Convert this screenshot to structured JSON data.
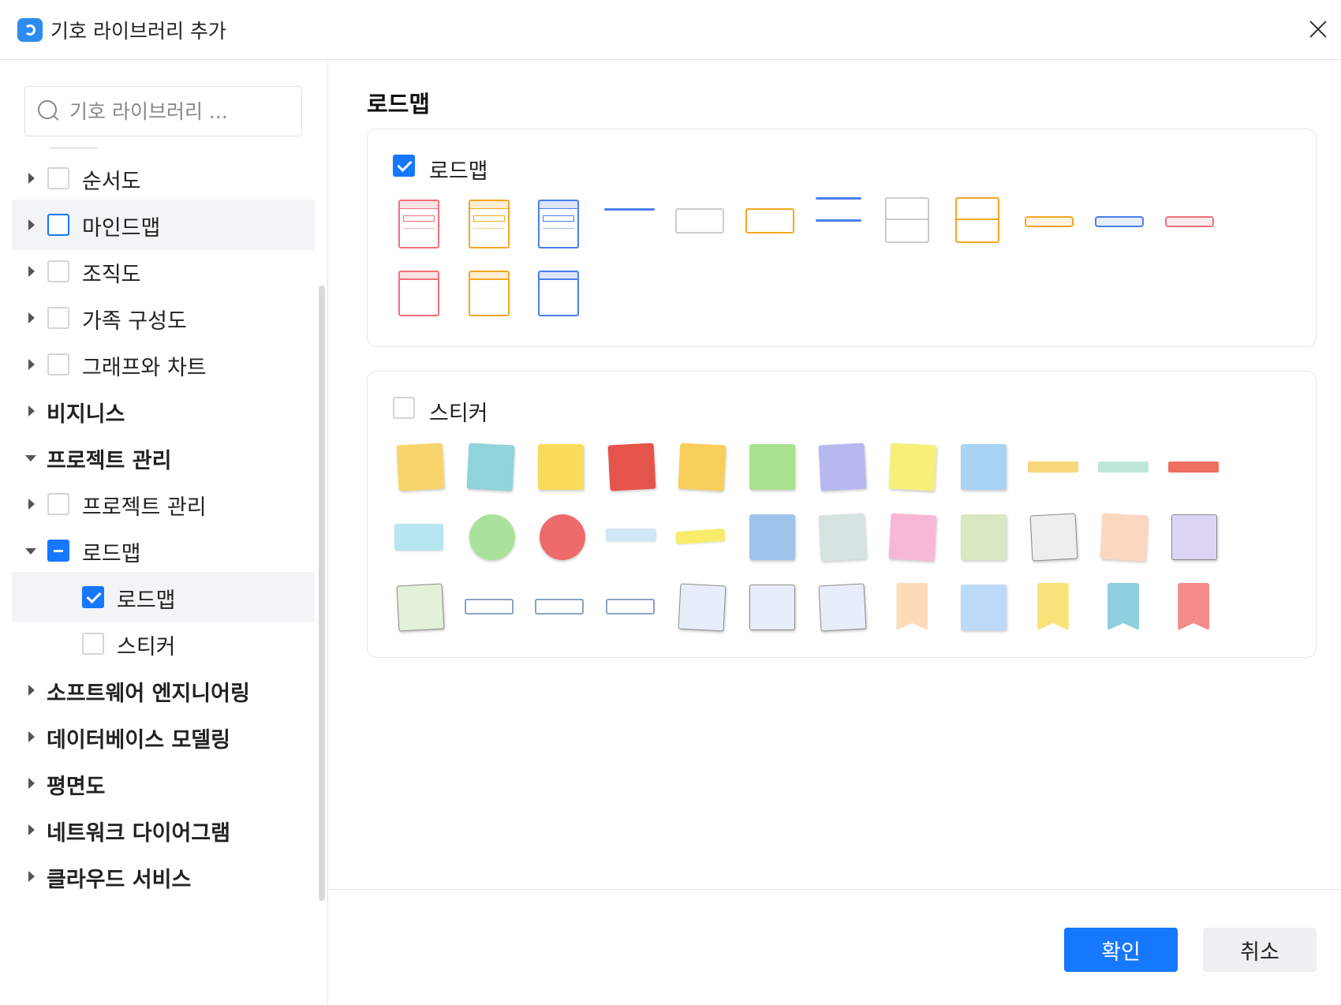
{
  "window": {
    "title": "기호 라이브러리 추가"
  },
  "search": {
    "placeholder": "기호 라이브러리 ..."
  },
  "tree": [
    {
      "label": "순서도",
      "bold": false,
      "level": 1,
      "arrow": "right",
      "checkbox": "empty",
      "highlight": false
    },
    {
      "label": "마인드맵",
      "bold": false,
      "level": 1,
      "arrow": "right",
      "checkbox": "empty-blue",
      "highlight": true
    },
    {
      "label": "조직도",
      "bold": false,
      "level": 1,
      "arrow": "right",
      "checkbox": "empty",
      "highlight": false
    },
    {
      "label": "가족 구성도",
      "bold": false,
      "level": 1,
      "arrow": "right",
      "checkbox": "empty",
      "highlight": false
    },
    {
      "label": "그래프와 차트",
      "bold": false,
      "level": 1,
      "arrow": "right",
      "checkbox": "empty",
      "highlight": false
    },
    {
      "label": "비지니스",
      "bold": true,
      "level": 0,
      "arrow": "right",
      "checkbox": "none",
      "highlight": false
    },
    {
      "label": "프로젝트 관리",
      "bold": true,
      "level": 0,
      "arrow": "down",
      "checkbox": "none",
      "highlight": false
    },
    {
      "label": "프로젝트 관리",
      "bold": false,
      "level": 1,
      "arrow": "right",
      "checkbox": "empty",
      "highlight": false
    },
    {
      "label": "로드맵",
      "bold": false,
      "level": 1,
      "arrow": "down",
      "checkbox": "partial",
      "highlight": false
    },
    {
      "label": "로드맵",
      "bold": false,
      "level": 2,
      "arrow": "none",
      "checkbox": "checked",
      "highlight": true
    },
    {
      "label": "스티커",
      "bold": false,
      "level": 2,
      "arrow": "none",
      "checkbox": "empty",
      "highlight": false
    },
    {
      "label": "소프트웨어 엔지니어링",
      "bold": true,
      "level": 0,
      "arrow": "right",
      "checkbox": "none",
      "highlight": false
    },
    {
      "label": "데이터베이스 모델링",
      "bold": true,
      "level": 0,
      "arrow": "right",
      "checkbox": "none",
      "highlight": false
    },
    {
      "label": "평면도",
      "bold": true,
      "level": 0,
      "arrow": "right",
      "checkbox": "none",
      "highlight": false
    },
    {
      "label": "네트워크 다이어그램",
      "bold": true,
      "level": 0,
      "arrow": "right",
      "checkbox": "none",
      "highlight": false
    },
    {
      "label": "클라우드 서비스",
      "bold": true,
      "level": 0,
      "arrow": "right",
      "checkbox": "none",
      "highlight": false
    }
  ],
  "main": {
    "title": "로드맵",
    "panels": [
      {
        "label": "로드맵",
        "checked": true
      },
      {
        "label": "스티커",
        "checked": false
      }
    ]
  },
  "roadmap_symbols": [
    {
      "name": "timeline-card-red",
      "color": "#f0707a"
    },
    {
      "name": "timeline-card-orange",
      "color": "#f5a623"
    },
    {
      "name": "timeline-card-blue",
      "color": "#4a7ef0"
    },
    {
      "name": "line-blue",
      "color": "#4a7ef0"
    },
    {
      "name": "box-gray",
      "color": "#cccccc"
    },
    {
      "name": "box-orange",
      "color": "#f5a623"
    },
    {
      "name": "double-line-blue",
      "color": "#4a7ef0"
    },
    {
      "name": "split-box-gray",
      "color": "#cccccc"
    },
    {
      "name": "split-box-orange",
      "color": "#f5a623"
    },
    {
      "name": "tag-orange",
      "color": "#f5a623"
    },
    {
      "name": "tag-blue",
      "color": "#4a7ef0"
    },
    {
      "name": "tag-red",
      "color": "#f0707a"
    },
    {
      "name": "swimlane-red",
      "color": "#f0707a"
    },
    {
      "name": "swimlane-orange",
      "color": "#f5a623"
    },
    {
      "name": "swimlane-blue",
      "color": "#4a7ef0"
    }
  ],
  "sticker_symbols": [
    {
      "name": "note-yellow",
      "color": "#f7d56b"
    },
    {
      "name": "note-teal",
      "color": "#8fd3db"
    },
    {
      "name": "note-yellow-pin",
      "color": "#f9dc5c"
    },
    {
      "name": "note-red",
      "color": "#e5544b"
    },
    {
      "name": "note-orange-curl",
      "color": "#f8cf5a"
    },
    {
      "name": "note-green-clip",
      "color": "#a9e28f"
    },
    {
      "name": "note-purple-clip",
      "color": "#b8b8f0"
    },
    {
      "name": "note-yellow-pushpin",
      "color": "#f6ef7a"
    },
    {
      "name": "note-blue-pushpin",
      "color": "#a9d3f5"
    },
    {
      "name": "tag-yellow",
      "color": "#f8d87a"
    },
    {
      "name": "tag-mint",
      "color": "#bfe8d8"
    },
    {
      "name": "tag-red-arrow",
      "color": "#f07060"
    },
    {
      "name": "note-cyan-tape",
      "color": "#b7e6f0"
    },
    {
      "name": "circle-green",
      "color": "#a9e29a"
    },
    {
      "name": "circle-red",
      "color": "#ee6b6b"
    },
    {
      "name": "tag-light-blue",
      "color": "#cfe6f7"
    },
    {
      "name": "ribbon-yellow",
      "color": "#f9ec6b"
    },
    {
      "name": "note-blue-clip",
      "color": "#9fc4ea"
    },
    {
      "name": "note-gray-tape",
      "color": "#d6e3e0"
    },
    {
      "name": "note-pink-pin",
      "color": "#f7b8d6"
    },
    {
      "name": "note-green-tape",
      "color": "#d8e8c2"
    },
    {
      "name": "note-notebook",
      "color": "#eeeeee"
    },
    {
      "name": "note-peach-pin",
      "color": "#fbd7c0"
    },
    {
      "name": "note-lavender-spiral",
      "color": "#dcd6f4"
    },
    {
      "name": "note-green-frame",
      "color": "#e2f1d8"
    },
    {
      "name": "arrow-right",
      "color": "#dde8f5"
    },
    {
      "name": "banner-left",
      "color": "#dde8f5"
    },
    {
      "name": "ribbon-flag",
      "color": "#dde8f5"
    },
    {
      "name": "paper-blue",
      "color": "#e8eef9"
    },
    {
      "name": "paper-torn",
      "color": "#e8eef9"
    },
    {
      "name": "paper-zigzag",
      "color": "#e8eef9"
    },
    {
      "name": "tag-peach",
      "color": "#fcdcb8"
    },
    {
      "name": "note-blue-fold",
      "color": "#bcdaf7"
    },
    {
      "name": "bookmark-yellow",
      "color": "#f9e27a"
    },
    {
      "name": "bookmark-teal",
      "color": "#8ed0df"
    },
    {
      "name": "bookmark-red",
      "color": "#f58a8a"
    }
  ],
  "buttons": {
    "ok": "확인",
    "cancel": "취소"
  }
}
